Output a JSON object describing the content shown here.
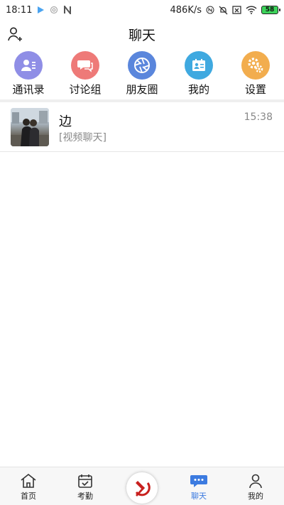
{
  "status_bar": {
    "time": "18:11",
    "net_speed": "486K/s",
    "battery": "58"
  },
  "header": {
    "title": "聊天"
  },
  "quick_menu": [
    {
      "label": "通讯录",
      "icon": "contacts-icon",
      "color": "#8f8ee6"
    },
    {
      "label": "讨论组",
      "icon": "discussion-icon",
      "color": "#ee7a78"
    },
    {
      "label": "朋友圈",
      "icon": "moments-icon",
      "color": "#5a86dc"
    },
    {
      "label": "我的",
      "icon": "profile-card-icon",
      "color": "#3fa9e0"
    },
    {
      "label": "设置",
      "icon": "settings-icon",
      "color": "#f2ad4e"
    }
  ],
  "chats": [
    {
      "name": "边",
      "preview": "[视频聊天]",
      "time": "15:38"
    }
  ],
  "bottom_nav": [
    {
      "label": "首页",
      "icon": "home-icon"
    },
    {
      "label": "考勤",
      "icon": "calendar-check-icon"
    },
    {
      "label": "",
      "icon": "party-emblem-icon"
    },
    {
      "label": "聊天",
      "icon": "chat-icon",
      "active": true
    },
    {
      "label": "我的",
      "icon": "user-icon"
    }
  ],
  "colors": {
    "accent": "#3c7be0"
  }
}
